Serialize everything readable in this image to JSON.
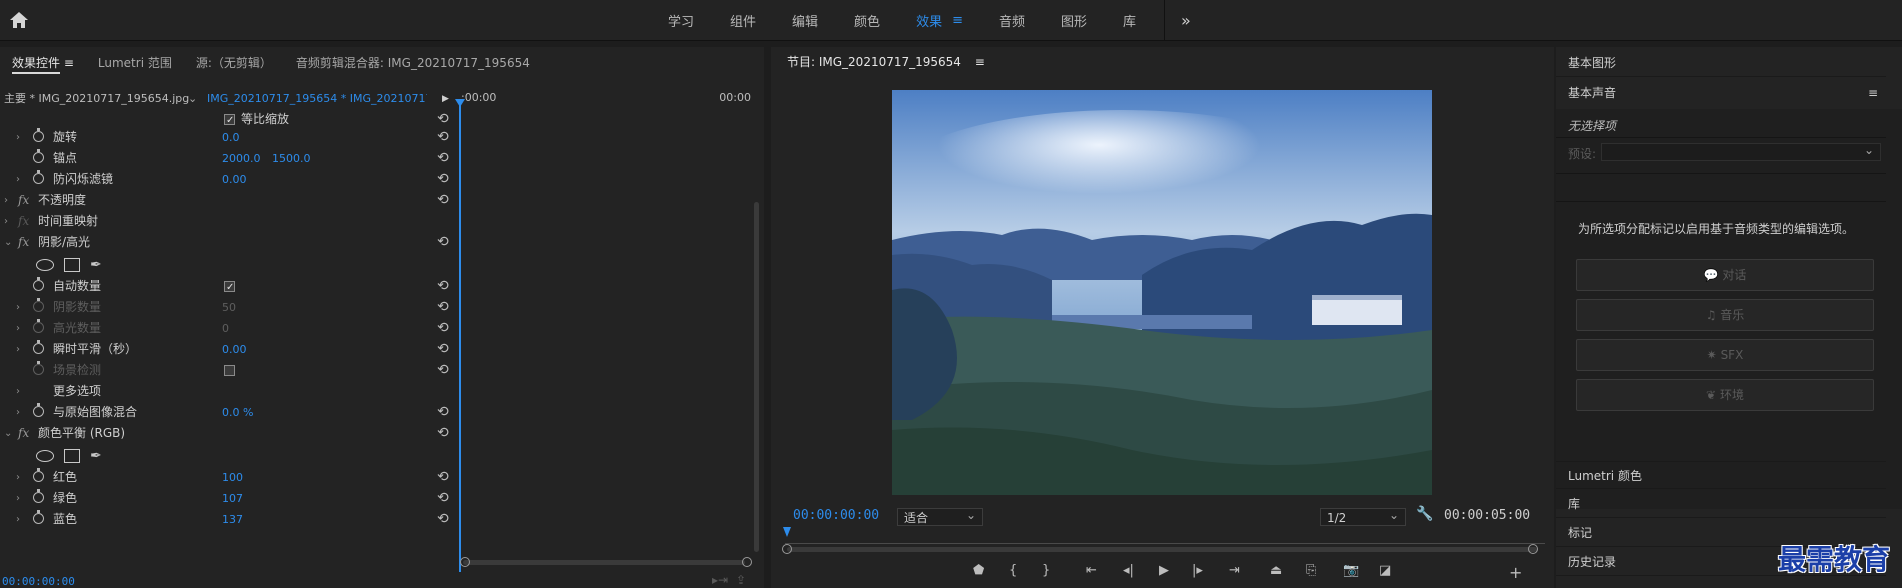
{
  "topbar": {
    "nav": [
      "学习",
      "组件",
      "编辑",
      "颜色",
      "效果",
      "音频",
      "图形",
      "库"
    ],
    "active": "效果",
    "more": "»"
  },
  "left": {
    "tabs": [
      "效果控件",
      "Lumetri 范围",
      "源:（无剪辑）",
      "音频剪辑混合器: IMG_20210717_195654"
    ],
    "tab_menu": "≡",
    "clip_master": "主要 * IMG_20210717_195654.jpg",
    "clip_seq": "IMG_20210717_195654 * IMG_20210717_...",
    "tl_start": ":00:00",
    "tl_end": "00:00",
    "uniform_scale": "等比缩放",
    "rows": [
      {
        "label": "旋转",
        "value": "0.0"
      },
      {
        "label": "锚点",
        "value": "2000.0",
        "value2": "1500.0"
      },
      {
        "label": "防闪烁滤镜",
        "value": "0.00"
      }
    ],
    "fx_opacity": "不透明度",
    "fx_time": "时间重映射",
    "fx_shadow": "阴影/高光",
    "shadow_rows": [
      {
        "label": "自动数量"
      },
      {
        "label": "阴影数量",
        "value": "50"
      },
      {
        "label": "高光数量",
        "value": "0"
      },
      {
        "label": "瞬时平滑（秒）",
        "value": "0.00"
      },
      {
        "label": "场景检测"
      },
      {
        "label": "更多选项"
      },
      {
        "label": "与原始图像混合",
        "value": "0.0 %"
      }
    ],
    "fx_color": "颜色平衡 (RGB)",
    "color_rows": [
      {
        "label": "红色",
        "value": "100"
      },
      {
        "label": "绿色",
        "value": "107"
      },
      {
        "label": "蓝色",
        "value": "137"
      }
    ],
    "timecode": "00:00:00:00",
    "fx_label": "fx"
  },
  "program": {
    "title": "节目: IMG_20210717_195654",
    "menu": "≡",
    "timecode_in": "00:00:00:00",
    "fit": "适合",
    "res": "1/2",
    "timecode_out": "00:00:05:00",
    "add": "+"
  },
  "right": {
    "basic_graphics": "基本图形",
    "basic_sound": "基本声音",
    "menu": "≡",
    "no_selection": "无选择项",
    "preset_label": "预设:",
    "hint": "为所选项分配标记以启用基于音频类型的编辑选项。",
    "buttons": [
      "对话",
      "音乐",
      "SFX",
      "环境"
    ],
    "bottom": [
      "Lumetri 颜色",
      "库",
      "标记",
      "历史记录"
    ]
  },
  "watermark": "最需教育",
  "colors": {
    "accent": "#2d8ceb",
    "panel": "#232323",
    "bg": "#1d1d1d"
  }
}
